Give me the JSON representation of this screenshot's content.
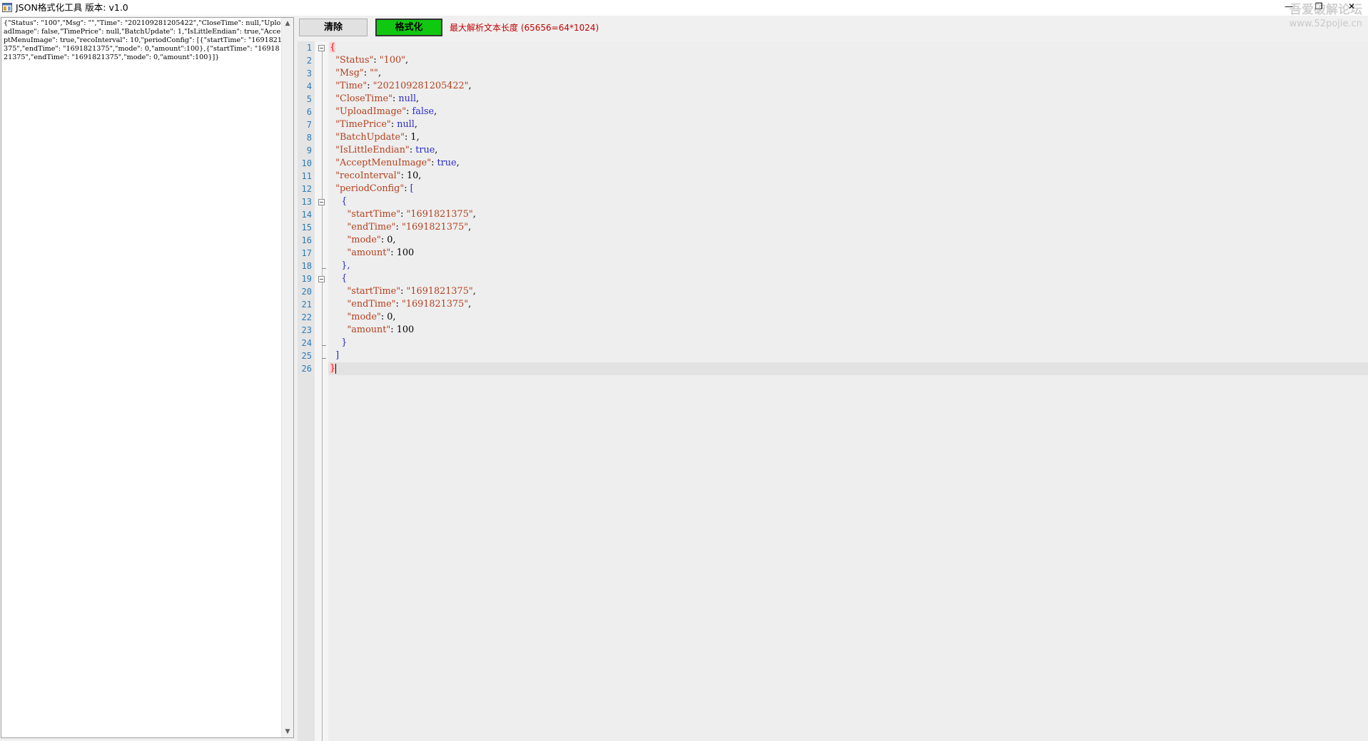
{
  "window": {
    "title": "JSON格式化工具  版本: v1.0",
    "controls": {
      "minimize": "—",
      "restore": "❐",
      "close": "✕"
    }
  },
  "watermark": {
    "line1": "吾爱破解论坛",
    "line2": "www.52pojie.cn"
  },
  "toolbar": {
    "clear_label": "清除",
    "format_label": "格式化",
    "max_length_note": "最大解析文本长度 (65656=64*1024)"
  },
  "raw_input": {
    "text": "{\"Status\": \"100\",\"Msg\": \"\",\"Time\": \"202109281205422\",\"CloseTime\": null,\"UploadImage\": false,\"TimePrice\": null,\"BatchUpdate\": 1,\"IsLittleEndian\": true,\"AcceptMenuImage\": true,\"recoInterval\": 10,\"periodConfig\": [{\"startTime\": \"1691821375\",\"endTime\": \"1691821375\",\"mode\": 0,\"amount\":100},{\"startTime\": \"1691821375\",\"endTime\": \"1691821375\",\"mode\": 0,\"amount\":100}]}"
  },
  "editor": {
    "line_numbers": [
      "1",
      "2",
      "3",
      "4",
      "5",
      "6",
      "7",
      "8",
      "9",
      "10",
      "11",
      "12",
      "13",
      "14",
      "15",
      "16",
      "17",
      "18",
      "19",
      "20",
      "21",
      "22",
      "23",
      "24",
      "25",
      "26"
    ],
    "lines": [
      [
        "{"
      ],
      [
        "  ",
        "\"Status\"",
        ": ",
        "\"100\"",
        ","
      ],
      [
        "  ",
        "\"Msg\"",
        ": ",
        "\"\"",
        ","
      ],
      [
        "  ",
        "\"Time\"",
        ": ",
        "\"202109281205422\"",
        ","
      ],
      [
        "  ",
        "\"CloseTime\"",
        ": ",
        "null",
        ","
      ],
      [
        "  ",
        "\"UploadImage\"",
        ": ",
        "false",
        ","
      ],
      [
        "  ",
        "\"TimePrice\"",
        ": ",
        "null",
        ","
      ],
      [
        "  ",
        "\"BatchUpdate\"",
        ": ",
        "1",
        ","
      ],
      [
        "  ",
        "\"IsLittleEndian\"",
        ": ",
        "true",
        ","
      ],
      [
        "  ",
        "\"AcceptMenuImage\"",
        ": ",
        "true",
        ","
      ],
      [
        "  ",
        "\"recoInterval\"",
        ": ",
        "10",
        ","
      ],
      [
        "  ",
        "\"periodConfig\"",
        ": ",
        "[",
        ""
      ],
      [
        "    {"
      ],
      [
        "      ",
        "\"startTime\"",
        ": ",
        "\"1691821375\"",
        ","
      ],
      [
        "      ",
        "\"endTime\"",
        ": ",
        "\"1691821375\"",
        ","
      ],
      [
        "      ",
        "\"mode\"",
        ": ",
        "0",
        ","
      ],
      [
        "      ",
        "\"amount\"",
        ": ",
        "100",
        ""
      ],
      [
        "    },"
      ],
      [
        "    {"
      ],
      [
        "      ",
        "\"startTime\"",
        ": ",
        "\"1691821375\"",
        ","
      ],
      [
        "      ",
        "\"endTime\"",
        ": ",
        "\"1691821375\"",
        ","
      ],
      [
        "      ",
        "\"mode\"",
        ": ",
        "0",
        ","
      ],
      [
        "      ",
        "\"amount\"",
        ": ",
        "100",
        ""
      ],
      [
        "    }"
      ],
      [
        "  ]"
      ],
      [
        "}"
      ]
    ],
    "fold_marker_lines": [
      1,
      13,
      19
    ]
  },
  "colors": {
    "key": "#b3401f",
    "string": "#b3401f",
    "keyword": "#2a2ac8",
    "line_number": "#2b7bb8",
    "format_button": "#10c810",
    "note": "#c00000"
  },
  "icons": {
    "app": "app-window-icon",
    "scroll_up": "chevron-up-icon",
    "scroll_down": "chevron-down-icon"
  }
}
